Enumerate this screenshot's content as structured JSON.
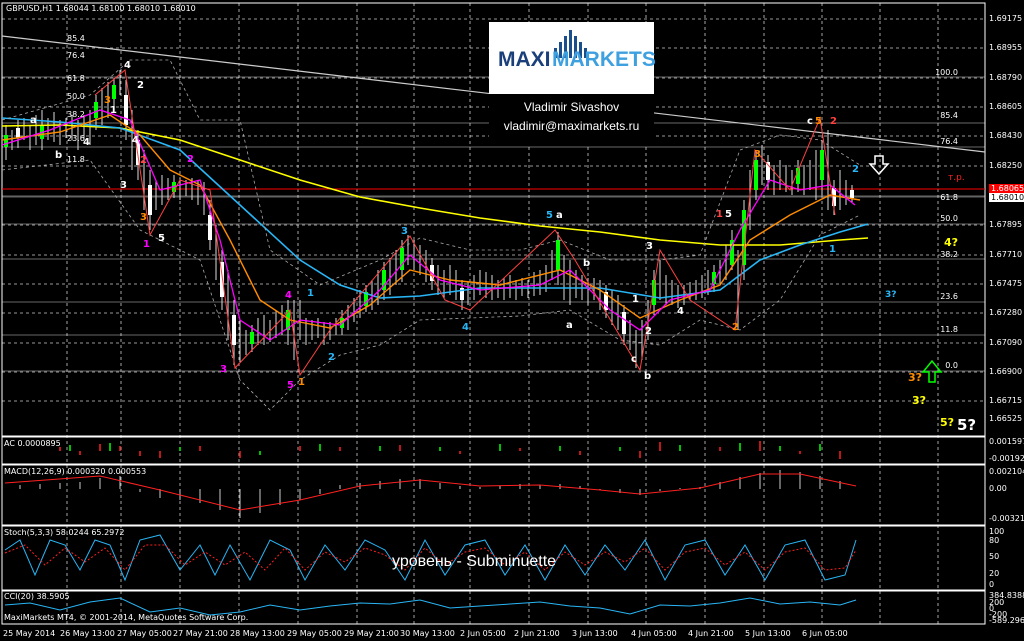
{
  "window": {
    "header": "GBPUSD,H1  1.68044 1.68100 1.68010 1.68010"
  },
  "logo": {
    "word_a": "MAXI",
    "word_b": "MARKETS",
    "author": "Vladimir Sivashov",
    "email": "vladimir@maximarkets.ru"
  },
  "price_axis": [
    "1.69175",
    "1.68955",
    "1.68790",
    "1.68605",
    "1.68430",
    "1.68250",
    "1.68065",
    "1.68010",
    "1.67895",
    "1.67710",
    "1.67475",
    "1.67280",
    "1.67090",
    "1.66900",
    "1.66715",
    "1.66525"
  ],
  "fib_levels": [
    "100.0",
    "85.4",
    "76.4",
    "61.8",
    "50.0",
    "38.2",
    "23.6",
    "11.8",
    "0.0"
  ],
  "fib_levels_left": [
    "85.4",
    "76.4",
    "61.8",
    "50.0",
    "38.2",
    "23.6",
    "11.8"
  ],
  "annotations": {
    "tp": "т.р.",
    "q4": "4?",
    "q3a": "3?",
    "q3b": "3?",
    "q3c": "3?",
    "q5a": "5?",
    "q5b": "5?"
  },
  "indicators": {
    "ac": {
      "label": "AC 0.0000895",
      "ticks": [
        "0.0015977",
        "-0.0019238"
      ]
    },
    "macd": {
      "label": "MACD(12,26,9) 0.000320 0.000553",
      "ticks": [
        "0.002104",
        "0.00",
        "-0.003217"
      ]
    },
    "stoch": {
      "label": "Stoch(5,3,3) 58.0244 65.2972",
      "ticks": [
        "100",
        "80",
        "50",
        "20",
        "0"
      ]
    },
    "cci": {
      "label": "CCI(20) 38.5905",
      "ticks": [
        "384.8388",
        "200",
        "0",
        "-200",
        "-589.2969"
      ],
      "copyright": "MaxiMarkets MT4, © 2001-2014, MetaQuotes Software Corp."
    }
  },
  "caption": "уровень - Subminuette",
  "date_axis": [
    "25 May 2014",
    "26 May 13:00",
    "27 May 05:00",
    "27 May 21:00",
    "28 May 13:00",
    "29 May 05:00",
    "29 May 21:00",
    "30 May 13:00",
    "2 Jun 05:00",
    "2 Jun 21:00",
    "3 Jun 13:00",
    "4 Jun 05:00",
    "4 Jun 21:00",
    "5 Jun 13:00",
    "6 Jun 05:00"
  ],
  "price_badges": {
    "current": "1.68065",
    "bid": "1.68010"
  },
  "colors": {
    "background": "#000000",
    "up_candle": "#00ff00",
    "grid": "#ffffff",
    "ma_yellow": "#ffff00",
    "ma_cyan": "#29b6f6",
    "ma_orange": "#ff8c00",
    "ma_magenta": "#ff00ff",
    "red_line": "#ff0000"
  }
}
